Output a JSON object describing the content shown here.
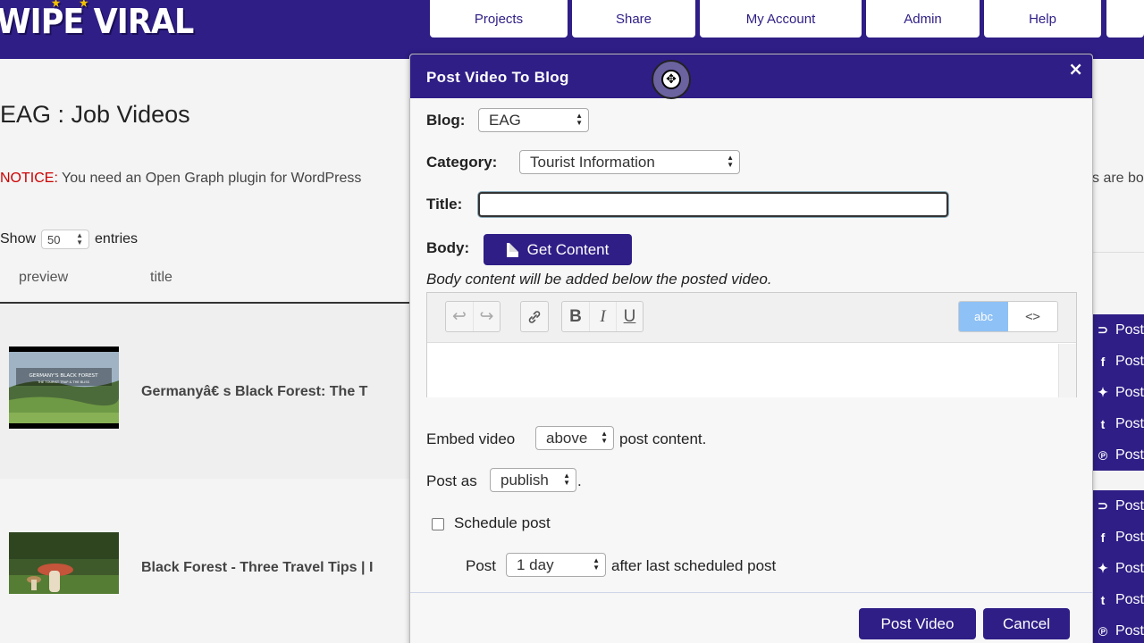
{
  "app": {
    "logo_text": "WIPE VIRAL"
  },
  "nav": {
    "tabs": [
      {
        "label": "Projects"
      },
      {
        "label": "Share"
      },
      {
        "label": "My Account"
      },
      {
        "label": "Admin"
      },
      {
        "label": "Help"
      }
    ]
  },
  "page": {
    "title": "EAG : Job Videos",
    "notice_label": "NOTICE:",
    "notice_text": " You need an Open Graph plugin for WordPress",
    "notice_tail": "s are bo",
    "show_label": "Show",
    "entries_value": "50",
    "entries_label": "entries",
    "columns": [
      "preview",
      "title"
    ],
    "rows": [
      {
        "title": "Germanyâ€   s Black Forest: The T",
        "thumb_caption_1": "GERMANY'S BLACK FOREST",
        "thumb_caption_2": "THE TOURIST TRAP & THE BLISS"
      },
      {
        "title": "Black Forest - Three Travel Tips | I"
      }
    ],
    "social_label": "Post",
    "social_icons": [
      "rss-icon",
      "facebook-icon",
      "twitter-icon",
      "tumblr-icon",
      "pinterest-icon"
    ]
  },
  "modal": {
    "title": "Post Video To Blog",
    "close_glyph": "×",
    "blog_label": "Blog:",
    "blog_value": "EAG",
    "category_label": "Category:",
    "category_value": "Tourist Information",
    "title_label": "Title:",
    "title_value": "",
    "body_label": "Body:",
    "get_content_label": "Get Content",
    "body_hint": "Body content will be added below the posted video.",
    "editor": {
      "undo_glyph": "↩",
      "redo_glyph": "↪",
      "link_glyph": "🔗",
      "bold_glyph": "B",
      "italic_glyph": "I",
      "underline_glyph": "U",
      "mode_visual": "abc",
      "mode_code": "<>"
    },
    "embed_prefix": "Embed video",
    "embed_value": "above",
    "embed_suffix": "post content.",
    "postas_prefix": "Post as",
    "postas_value": "publish",
    "postas_suffix": ".",
    "schedule_label": "Schedule post",
    "schedule_checked": false,
    "schedule_prefix": "Post",
    "schedule_value": "1 day",
    "schedule_suffix": "after last scheduled post",
    "post_button": "Post Video",
    "cancel_button": "Cancel"
  },
  "colors": {
    "brand": "#2e1e86",
    "notice": "#cc0000",
    "mode_active": "#8ec1f6"
  }
}
